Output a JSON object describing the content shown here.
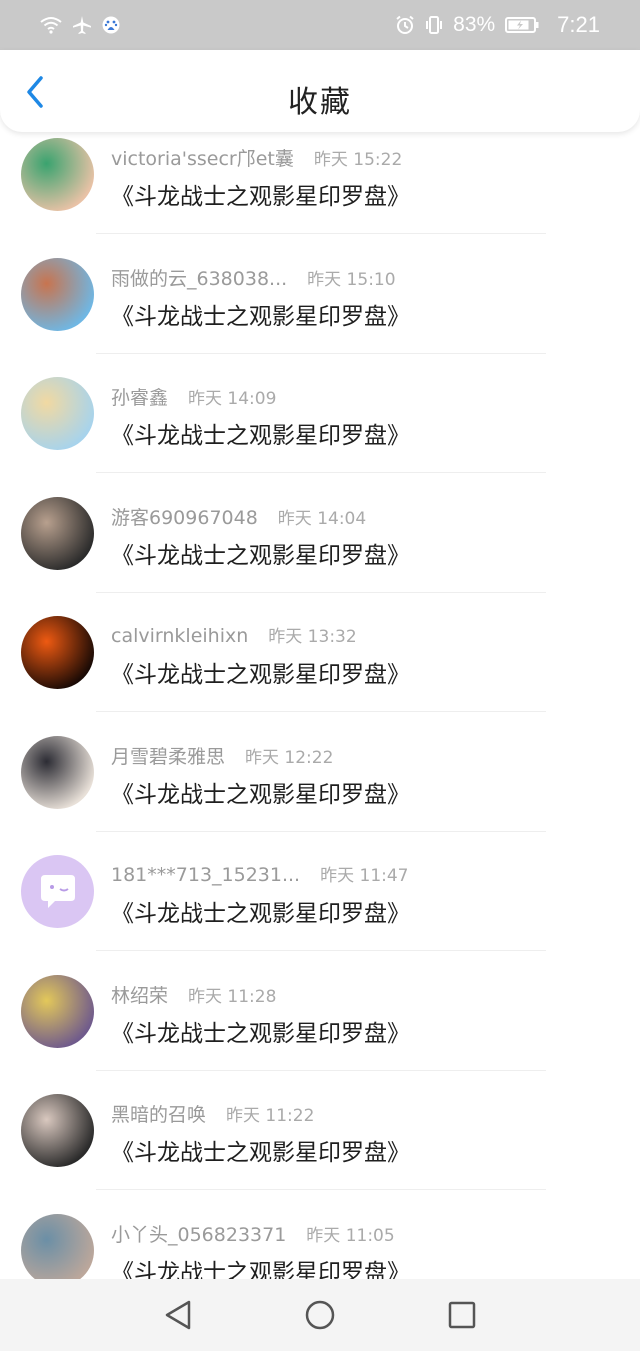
{
  "status_bar": {
    "battery_percent": "83%",
    "time": "7:21"
  },
  "header": {
    "title": "收藏"
  },
  "items": [
    {
      "name": "victoria'ssecr邝et囊",
      "time": "昨天 15:22",
      "title": "《斗龙战士之观影星印罗盘》",
      "avatar_colors": [
        "#e9c2a6",
        "#3aa36f"
      ]
    },
    {
      "name": "雨做的云_638038...",
      "time": "昨天 15:10",
      "title": "《斗龙战士之观影星印罗盘》",
      "avatar_colors": [
        "#6fb7e4",
        "#c8744f"
      ]
    },
    {
      "name": "孙睿鑫",
      "time": "昨天 14:09",
      "title": "《斗龙战士之观影星印罗盘》",
      "avatar_colors": [
        "#a7d3ec",
        "#f1d9a2"
      ]
    },
    {
      "name": "游客690967048",
      "time": "昨天 14:04",
      "title": "《斗龙战士之观影星印罗盘》",
      "avatar_colors": [
        "#2b2b2b",
        "#b8a08e"
      ]
    },
    {
      "name": "calvirnkleihixn",
      "time": "昨天 13:32",
      "title": "《斗龙战士之观影星印罗盘》",
      "avatar_colors": [
        "#1a0a05",
        "#ee5a12"
      ]
    },
    {
      "name": "月雪碧柔雅思",
      "time": "昨天 12:22",
      "title": "《斗龙战士之观影星印罗盘》",
      "avatar_colors": [
        "#e8e0d8",
        "#2c2c34"
      ]
    },
    {
      "name": "181***713_15231...",
      "time": "昨天 11:47",
      "title": "《斗龙战士之观影星印罗盘》",
      "avatar_colors": [
        "#dac6f3",
        "#ffffff"
      ]
    },
    {
      "name": "林绍荣",
      "time": "昨天 11:28",
      "title": "《斗龙战士之观影星印罗盘》",
      "avatar_colors": [
        "#6f5a8c",
        "#e3c85a"
      ]
    },
    {
      "name": "黑暗的召唤",
      "time": "昨天 11:22",
      "title": "《斗龙战士之观影星印罗盘》",
      "avatar_colors": [
        "#2a2a2a",
        "#d9c8bf"
      ]
    },
    {
      "name": "小丫头_056823371",
      "time": "昨天 11:05",
      "title": "《斗龙战士之观影星印罗盘》",
      "avatar_colors": [
        "#bca79b",
        "#6b8fa6"
      ]
    }
  ],
  "colors": {
    "accent": "#1e88e5",
    "status_bar_bg": "#c9c9c9",
    "nav_bar_bg": "#f4f4f4"
  }
}
